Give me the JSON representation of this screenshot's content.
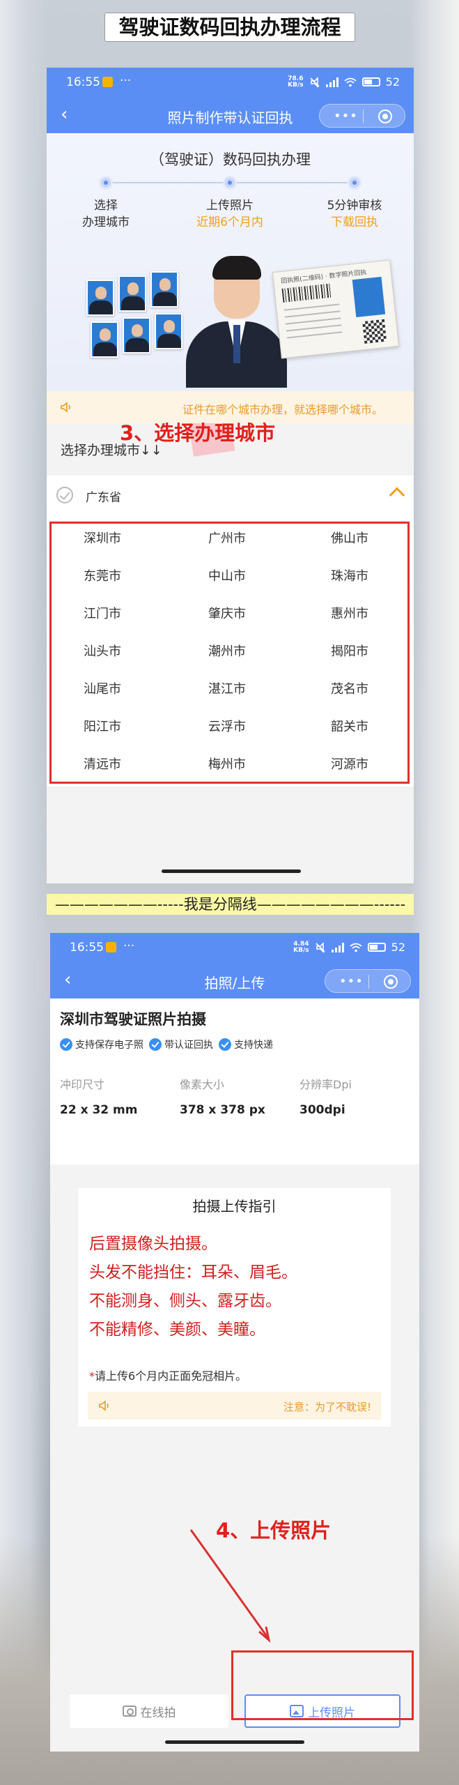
{
  "page_title": "驾驶证数码回执办理流程",
  "screen1": {
    "status": {
      "time": "16:55",
      "speed_top": "78.6",
      "speed_bottom": "KB/s",
      "battery": "52",
      "more": "···"
    },
    "nav": {
      "title": "照片制作带认证回执",
      "back": "‹"
    },
    "banner": {
      "heading": "（驾驶证）数码回执办理",
      "steps": [
        {
          "line1": "选择",
          "line2": "办理城市"
        },
        {
          "line1": "上传照片",
          "line2": "近期6个月内"
        },
        {
          "line1": "5分钟审核",
          "line2": "下载回执"
        }
      ],
      "license_title": "回执照(二维码) · 数字照片回执"
    },
    "notice": "证件在哪个城市办理，就选择哪个城市。",
    "section_label": "选择办理城市↓↓",
    "province": "广东省",
    "annotation": "3、选择办理城市",
    "cities": [
      "深圳市",
      "广州市",
      "佛山市",
      "东莞市",
      "中山市",
      "珠海市",
      "江门市",
      "肇庆市",
      "惠州市",
      "汕头市",
      "潮州市",
      "揭阳市",
      "汕尾市",
      "湛江市",
      "茂名市",
      "阳江市",
      "云浮市",
      "韶关市",
      "清远市",
      "梅州市",
      "河源市"
    ]
  },
  "divider_text": "———————-----我是分隔线————————------",
  "screen2": {
    "status": {
      "time": "16:55",
      "speed_top": "4.84",
      "speed_bottom": "KB/s",
      "battery": "52",
      "more": "···"
    },
    "nav": {
      "title": "拍照/上传",
      "back": "‹"
    },
    "title": "深圳市驾驶证照片拍摄",
    "tags": [
      "支持保存电子照",
      "带认证回执",
      "支持快递"
    ],
    "specs": [
      {
        "label": "冲印尺寸",
        "value": "22 x 32 mm"
      },
      {
        "label": "像素大小",
        "value": "378 x 378 px"
      },
      {
        "label": "分辨率Dpi",
        "value": "300dpi"
      }
    ],
    "guide": {
      "title": "拍摄上传指引",
      "lines": [
        "后置摄像头拍摄。",
        "头发不能挡住：耳朵、眉毛。",
        "不能测身、侧头、露牙齿。",
        "不能精修、美颜、美瞳。"
      ],
      "note_star": "*",
      "note": "请上传6个月内正面免冠相片。",
      "notice": "注意：为了不耽误!"
    },
    "annotation": "4、上传照片",
    "buttons": {
      "shoot": "在线拍",
      "upload": "上传照片"
    }
  },
  "colors": {
    "primary": "#5b8ef5",
    "annotation_red": "#e0201b",
    "accent_orange": "#f0a020"
  }
}
